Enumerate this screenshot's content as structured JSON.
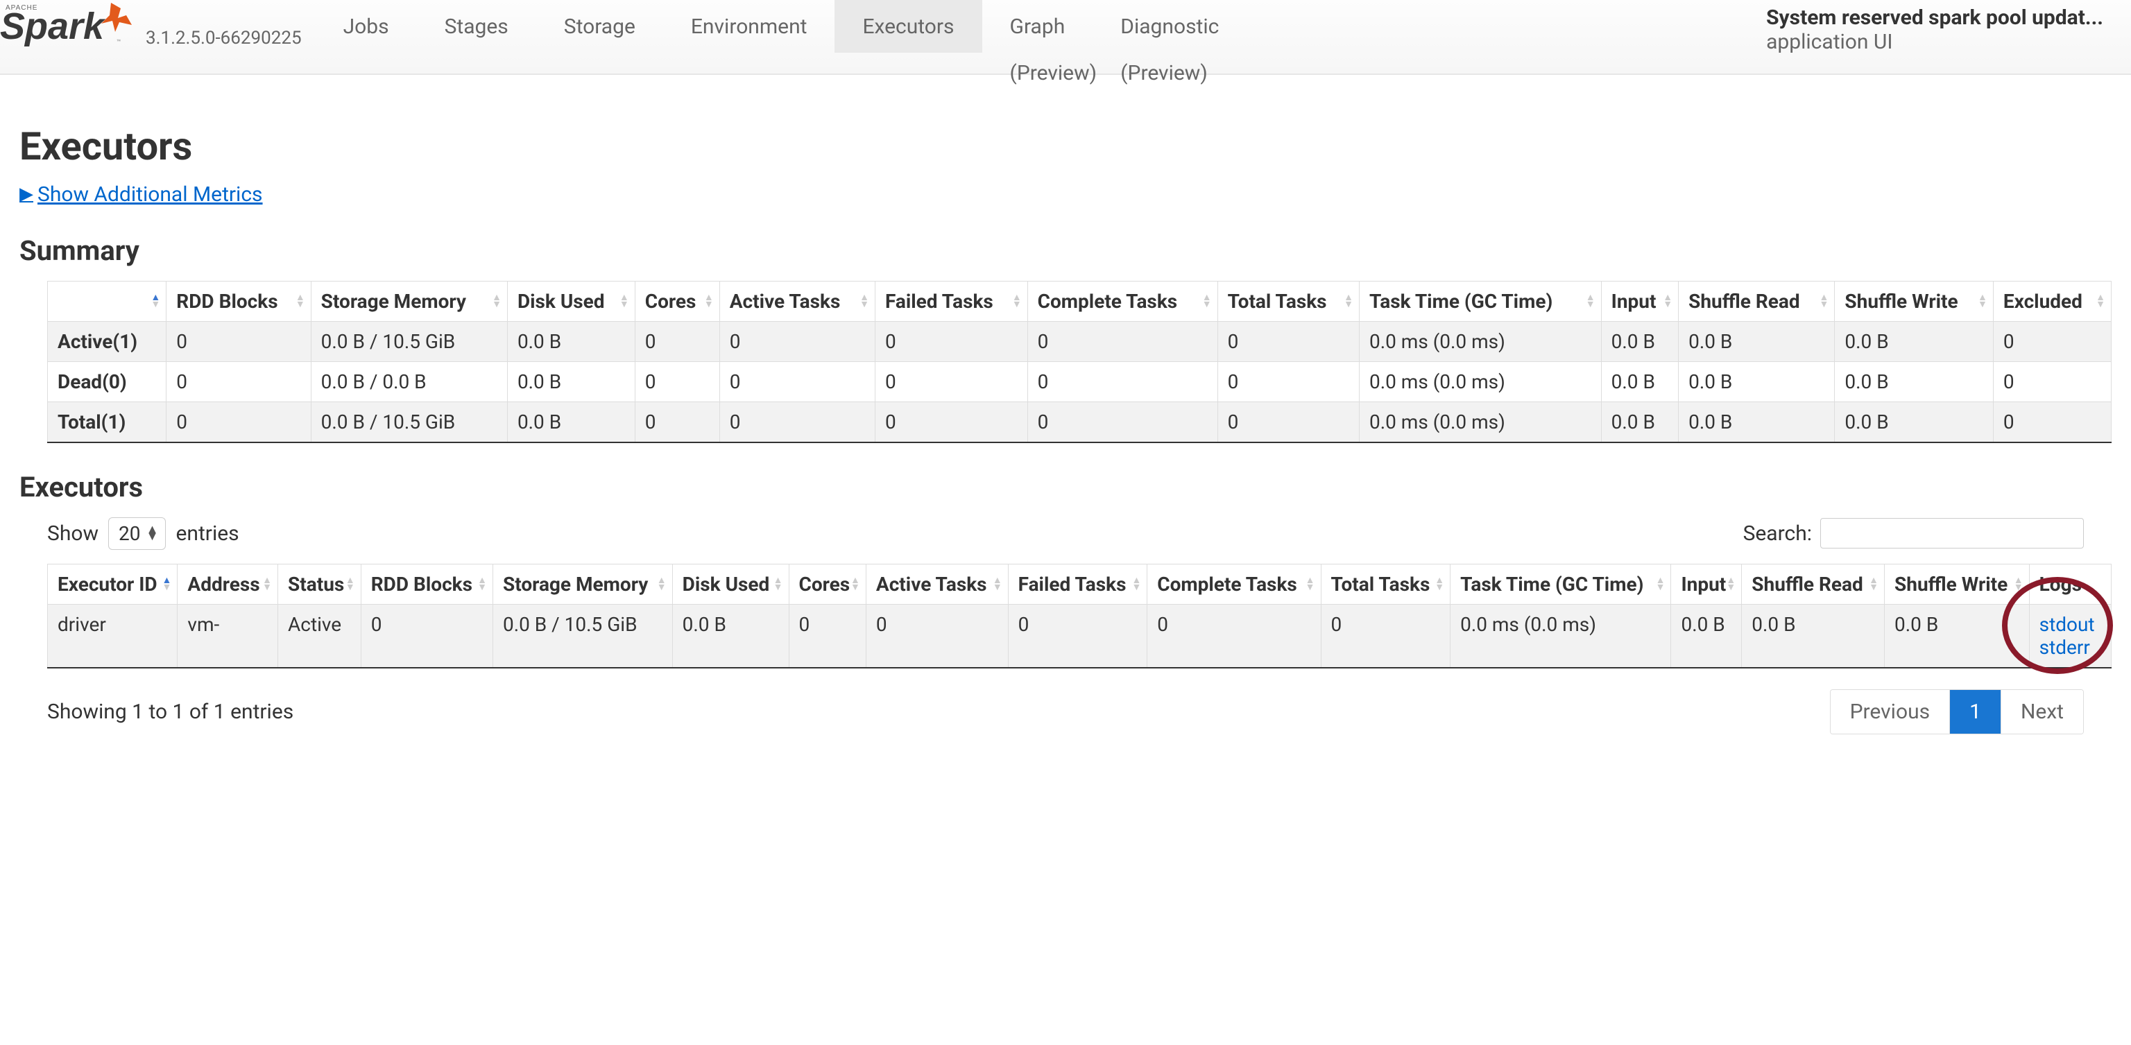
{
  "header": {
    "version": "3.1.2.5.0-66290225",
    "tabs": [
      {
        "label": "Jobs",
        "sub": ""
      },
      {
        "label": "Stages",
        "sub": ""
      },
      {
        "label": "Storage",
        "sub": ""
      },
      {
        "label": "Environment",
        "sub": ""
      },
      {
        "label": "Executors",
        "sub": ""
      },
      {
        "label": "Graph",
        "sub": "(Preview)"
      },
      {
        "label": "Diagnostic",
        "sub": "(Preview)"
      }
    ],
    "active_tab": "Executors",
    "app_title": "System reserved spark pool updat...",
    "app_sub": "application UI"
  },
  "page": {
    "title": "Executors",
    "toggle_link": "Show Additional Metrics",
    "summary_heading": "Summary",
    "executors_heading": "Executors"
  },
  "summary_table": {
    "headers": [
      "",
      "RDD Blocks",
      "Storage Memory",
      "Disk Used",
      "Cores",
      "Active Tasks",
      "Failed Tasks",
      "Complete Tasks",
      "Total Tasks",
      "Task Time (GC Time)",
      "Input",
      "Shuffle Read",
      "Shuffle Write",
      "Excluded"
    ],
    "rows": [
      {
        "label": "Active(1)",
        "cells": [
          "0",
          "0.0 B / 10.5 GiB",
          "0.0 B",
          "0",
          "0",
          "0",
          "0",
          "0",
          "0.0 ms (0.0 ms)",
          "0.0 B",
          "0.0 B",
          "0.0 B",
          "0"
        ]
      },
      {
        "label": "Dead(0)",
        "cells": [
          "0",
          "0.0 B / 0.0 B",
          "0.0 B",
          "0",
          "0",
          "0",
          "0",
          "0",
          "0.0 ms (0.0 ms)",
          "0.0 B",
          "0.0 B",
          "0.0 B",
          "0"
        ]
      },
      {
        "label": "Total(1)",
        "cells": [
          "0",
          "0.0 B / 10.5 GiB",
          "0.0 B",
          "0",
          "0",
          "0",
          "0",
          "0",
          "0.0 ms (0.0 ms)",
          "0.0 B",
          "0.0 B",
          "0.0 B",
          "0"
        ]
      }
    ]
  },
  "controls": {
    "show_label": "Show",
    "entries_value": "20",
    "entries_label": "entries",
    "search_label": "Search:",
    "search_value": ""
  },
  "executors_table": {
    "headers": [
      "Executor ID",
      "Address",
      "Status",
      "RDD Blocks",
      "Storage Memory",
      "Disk Used",
      "Cores",
      "Active Tasks",
      "Failed Tasks",
      "Complete Tasks",
      "Total Tasks",
      "Task Time (GC Time)",
      "Input",
      "Shuffle Read",
      "Shuffle Write",
      "Logs"
    ],
    "rows": [
      {
        "cells": [
          "driver",
          "vm-",
          "Active",
          "0",
          "0.0 B / 10.5 GiB",
          "0.0 B",
          "0",
          "0",
          "0",
          "0",
          "0",
          "0.0 ms (0.0 ms)",
          "0.0 B",
          "0.0 B",
          "0.0 B"
        ],
        "logs": [
          "stdout",
          "stderr"
        ]
      }
    ]
  },
  "footer": {
    "info": "Showing 1 to 1 of 1 entries",
    "previous": "Previous",
    "page": "1",
    "next": "Next"
  }
}
